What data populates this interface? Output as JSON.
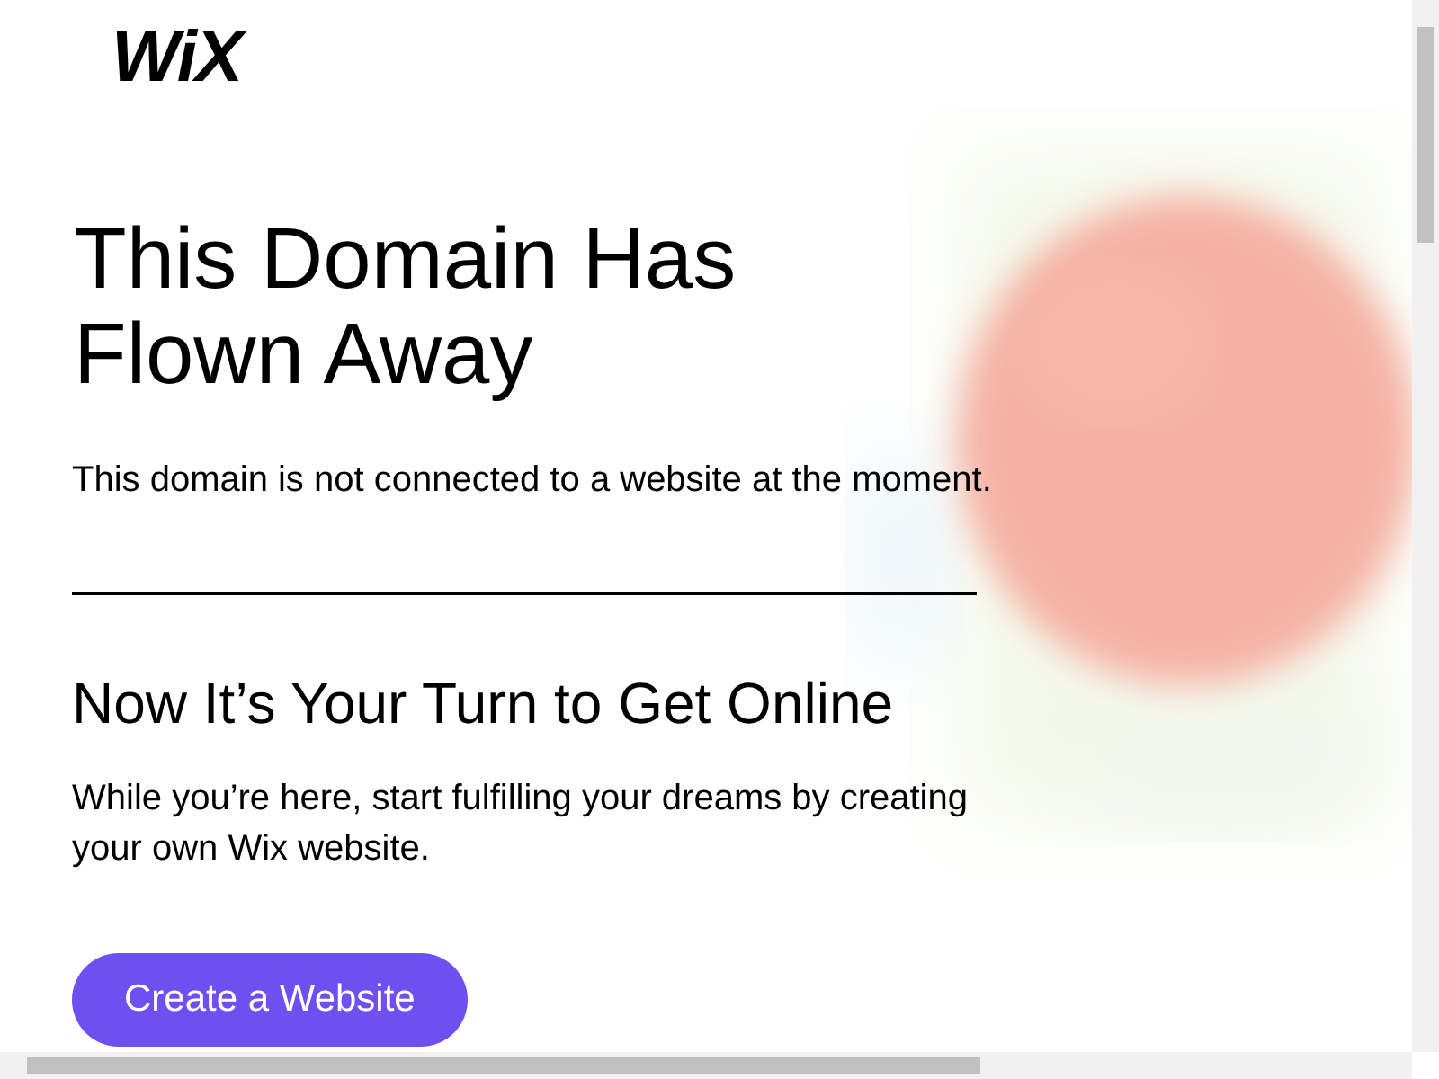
{
  "logo": "WiX",
  "title": "This Domain Has Flown Away",
  "subtitle": "This domain is not connected to a website at the moment.",
  "heading": "Now It’s Your Turn to Get Online",
  "body": "While you’re here, start fulfilling your dreams by creating your own Wix website.",
  "button": "Create a Website"
}
